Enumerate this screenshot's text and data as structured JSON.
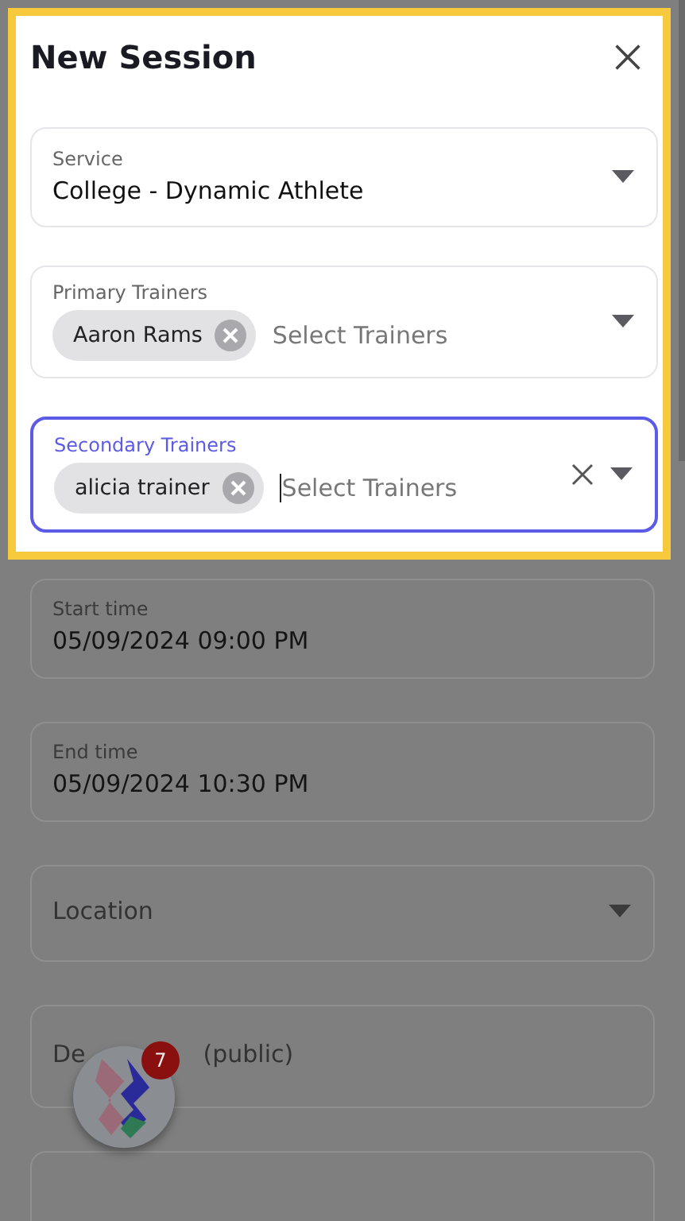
{
  "dialog": {
    "title": "New Session",
    "fields": [
      {
        "kind": "select",
        "label": "Service",
        "value": "College - Dynamic Athlete",
        "focused": false
      },
      {
        "kind": "multi",
        "label": "Primary Trainers",
        "chips": [
          "Aaron Rams"
        ],
        "placeholder": "Select Trainers",
        "focused": false,
        "clearable": false
      },
      {
        "kind": "multi",
        "label": "Secondary Trainers",
        "chips": [
          "alicia trainer"
        ],
        "placeholder": "Select Trainers",
        "focused": true,
        "clearable": true
      }
    ]
  },
  "background_form": {
    "fields": [
      {
        "kind": "text",
        "label": "Start time",
        "value": "05/09/2024 09:00 PM"
      },
      {
        "kind": "text",
        "label": "End time",
        "value": "05/09/2024 10:30 PM"
      },
      {
        "kind": "select",
        "label": "Location"
      },
      {
        "kind": "partial",
        "label_parts": [
          "De",
          "(public)"
        ]
      },
      {
        "kind": "empty"
      }
    ]
  },
  "floating_button": {
    "badge": "7"
  }
}
